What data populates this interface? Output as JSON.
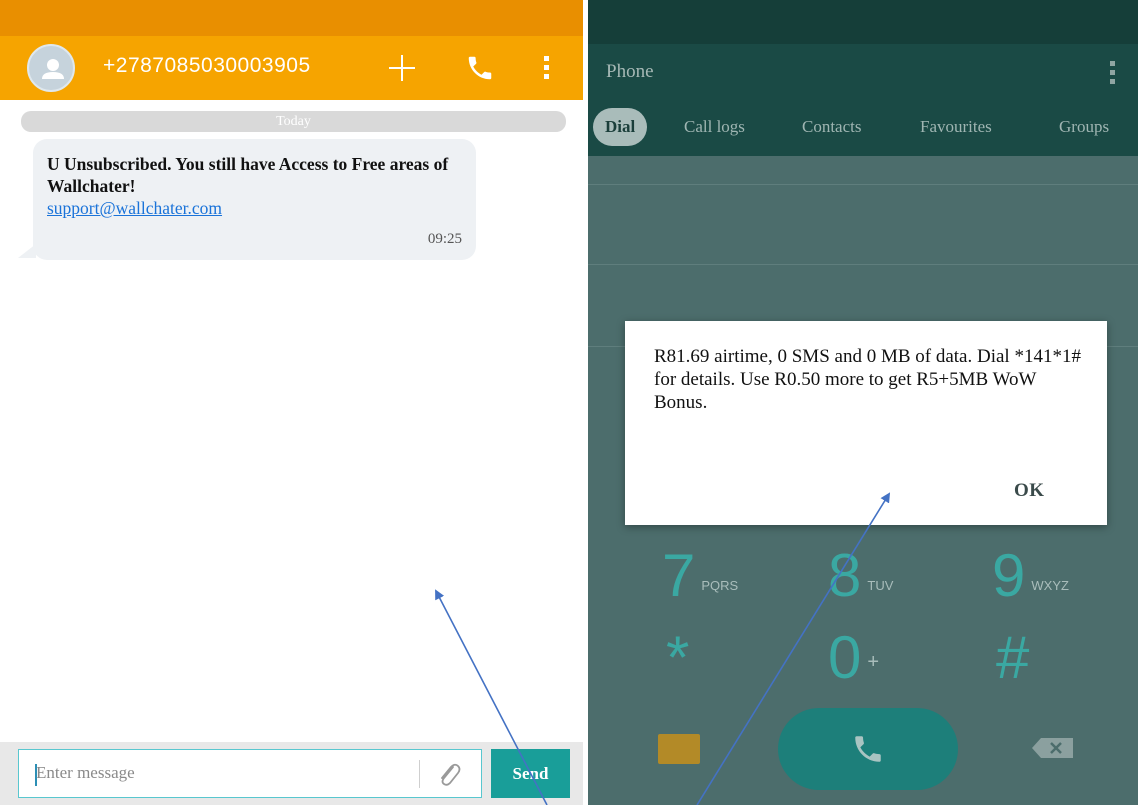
{
  "sms": {
    "contact_number": "+2787085030003905",
    "date_separator": "Today",
    "message": {
      "text": "U Unsubscribed. You still have Access to Free areas of Wallchater!",
      "link": "support@wallchater.com",
      "time": "09:25"
    },
    "compose": {
      "placeholder": "Enter message",
      "send_label": "Send"
    }
  },
  "phone": {
    "title": "Phone",
    "tabs": [
      {
        "label": "Dial",
        "active": true
      },
      {
        "label": "Call logs",
        "active": false
      },
      {
        "label": "Contacts",
        "active": false
      },
      {
        "label": "Favourites",
        "active": false
      },
      {
        "label": "Groups",
        "active": false
      }
    ],
    "keys": [
      {
        "digit": "7",
        "letters": "PQRS"
      },
      {
        "digit": "8",
        "letters": "TUV"
      },
      {
        "digit": "9",
        "letters": "WXYZ"
      },
      {
        "digit": "*",
        "letters": ""
      },
      {
        "digit": "0",
        "letters": "+"
      },
      {
        "digit": "#",
        "letters": ""
      }
    ],
    "dialog": {
      "text": "R81.69 airtime, 0 SMS and 0 MB of data. Dial *141*1# for details. Use R0.50 more to get R5+5MB WoW Bonus.",
      "ok_label": "OK"
    }
  },
  "colors": {
    "sms_header": "#f6a400",
    "phone_header": "#1a4a45",
    "accent_teal": "#199e99",
    "link_blue": "#1a73d9",
    "arrow_blue": "#4472c4"
  }
}
